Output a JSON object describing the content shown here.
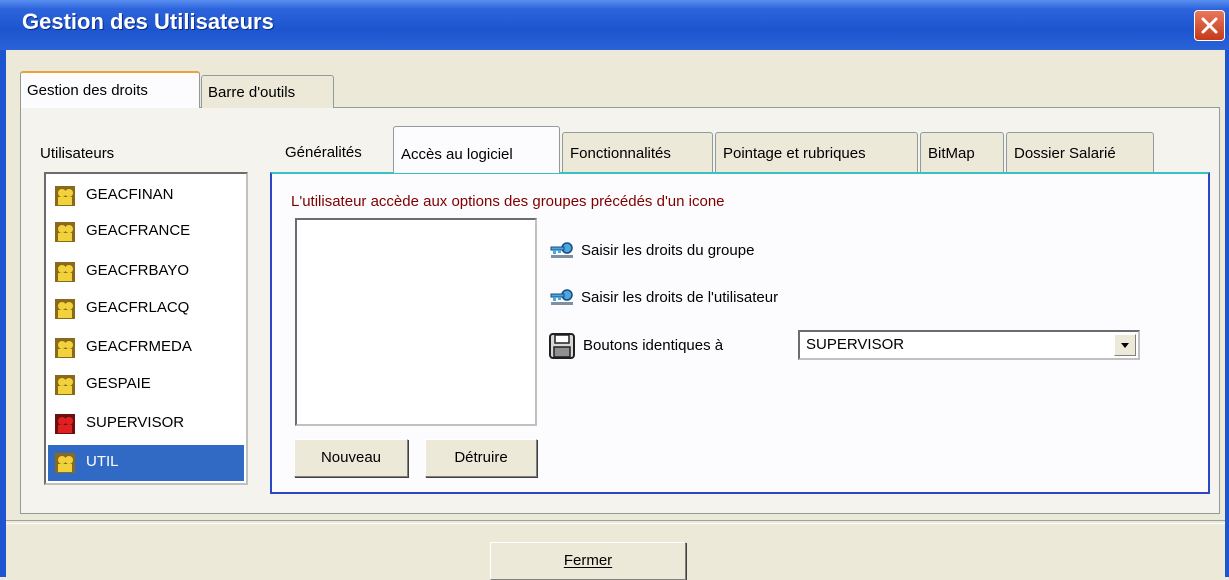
{
  "window": {
    "title": "Gestion des Utilisateurs"
  },
  "outer_tabs": [
    {
      "label": "Gestion des droits",
      "active": true
    },
    {
      "label": "Barre d'outils",
      "active": false
    }
  ],
  "users": {
    "label": "Utilisateurs",
    "items": [
      {
        "name": "GEACFINAN",
        "icon": "user-group-icon-yellow",
        "selected": false
      },
      {
        "name": "GEACFRANCE",
        "icon": "user-group-icon-yellow",
        "selected": false
      },
      {
        "name": "GEACFRBAYO",
        "icon": "user-group-icon-yellow",
        "selected": false
      },
      {
        "name": "GEACFRLACQ",
        "icon": "user-group-icon-yellow",
        "selected": false
      },
      {
        "name": "GEACFRMEDA",
        "icon": "user-group-icon-yellow",
        "selected": false
      },
      {
        "name": "GESPAIE",
        "icon": "user-group-icon-yellow",
        "selected": false
      },
      {
        "name": "SUPERVISOR",
        "icon": "user-group-icon-red",
        "selected": false
      },
      {
        "name": "UTIL",
        "icon": "user-group-icon-yellow",
        "selected": true
      }
    ]
  },
  "inner_tabs": [
    {
      "label": "Généralités",
      "active": false
    },
    {
      "label": "Accès au logiciel",
      "active": true
    },
    {
      "label": "Fonctionnalités",
      "active": false
    },
    {
      "label": "Pointage et rubriques",
      "active": false
    },
    {
      "label": "BitMap",
      "active": false
    },
    {
      "label": "Dossier Salarié",
      "active": false
    }
  ],
  "access": {
    "info_text": "L'utilisateur accède aux options des groupes précédés d'un icone",
    "info_color": "#800000",
    "group_rights_label": "Saisir les droits du groupe",
    "user_rights_label": "Saisir les droits de l'utilisateur",
    "identical_buttons_label": "Boutons identiques à",
    "identical_buttons_value": "SUPERVISOR",
    "new_button": "Nouveau",
    "delete_button": "Détruire"
  },
  "footer": {
    "close_button": "Fermer"
  },
  "colors": {
    "titlebar": "#1d55d0",
    "selection": "#316ac5",
    "active_tab_accent": "#e8a33a"
  }
}
